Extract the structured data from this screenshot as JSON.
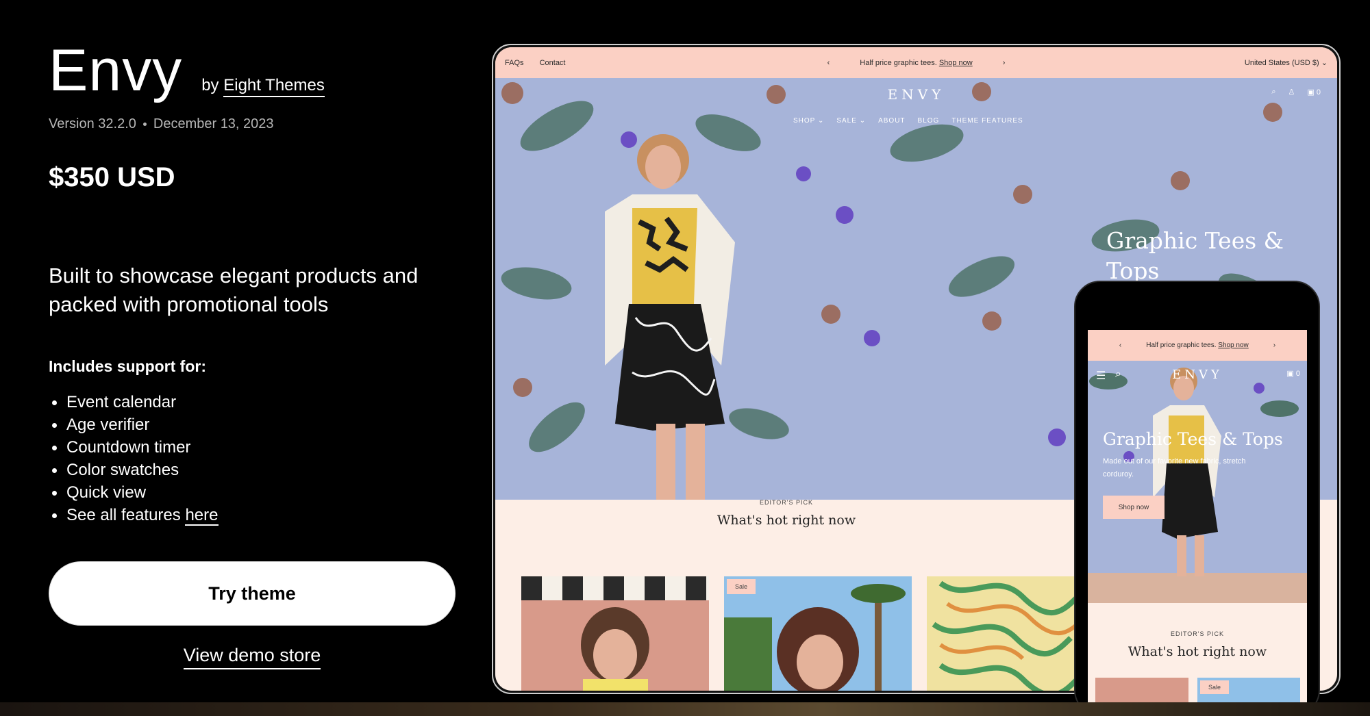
{
  "theme": {
    "name": "Envy",
    "by_prefix": "by",
    "author": "Eight Themes",
    "version": "Version 32.2.0",
    "date": "December 13, 2023",
    "price": "$350 USD",
    "tagline": "Built to showcase elegant products and packed with promotional tools",
    "support_heading": "Includes support for:",
    "features": [
      "Event calendar",
      "Age verifier",
      "Countdown timer",
      "Color swatches",
      "Quick view"
    ],
    "features_last_prefix": "See all features",
    "features_last_link": "here",
    "try_button": "Try theme",
    "demo_link": "View demo store"
  },
  "desktop": {
    "announce_links": [
      "FAQs",
      "Contact"
    ],
    "announce_text": "Half price graphic tees.",
    "announce_link": "Shop now",
    "currency": "United States (USD $)",
    "logo": "ENVY",
    "nav": [
      "SHOP",
      "SALE",
      "ABOUT",
      "BLOG",
      "THEME FEATURES"
    ],
    "cart_count": "0",
    "hero_title": "Graphic Tees & Tops",
    "editor_kicker": "EDITOR'S PICK",
    "editor_heading": "What's hot right now",
    "sale_badge": "Sale"
  },
  "mobile": {
    "announce_text": "Half price graphic tees.",
    "announce_link": "Shop now",
    "logo": "ENVY",
    "cart_count": "0",
    "hero_title": "Graphic Tees & Tops",
    "hero_sub": "Made out of our favorite new fabric, stretch corduroy.",
    "hero_button": "Shop now",
    "editor_kicker": "EDITOR'S PICK",
    "editor_heading": "What's hot right now",
    "sale_badge": "Sale"
  },
  "colors": {
    "background": "#000000",
    "announce_pink": "#fbd0c4",
    "hero_blue": "#a7b4d9",
    "section_cream": "#fdeee6"
  }
}
